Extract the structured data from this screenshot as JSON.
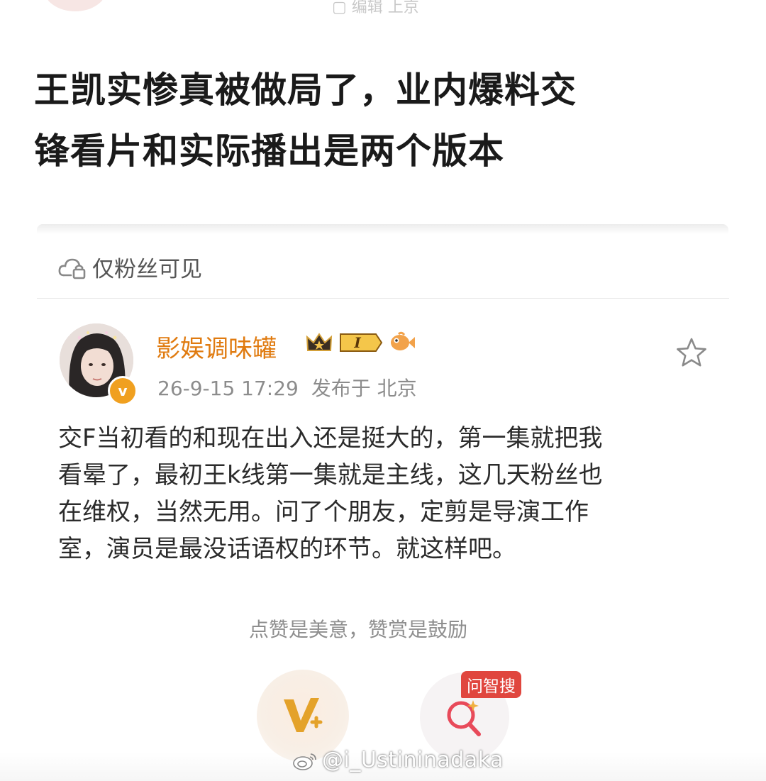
{
  "header": {
    "meta_partial": "▢ 编辑 上京"
  },
  "article": {
    "title_line1": "王凯实惨真被做局了，业内爆料交",
    "title_line2": "锋看片和实际播出是两个版本"
  },
  "post": {
    "visibility_label": "仅粉丝可见",
    "author_name": "影娱调味罐",
    "verified_mark": "v",
    "level_badge": "I",
    "timestamp": "26-9-15 17:29",
    "location": "发布于 北京",
    "body_lines": [
      "交F当初看的和现在出入还是挺大的，第一集就把我",
      "看晕了，最初王k线第一集就是主线，这几天粉丝也",
      "在维权，当然无用。问了个朋友，定剪是导演工作",
      "室，演员是最没话语权的环节。就这样吧。"
    ]
  },
  "actions": {
    "like_hint": "点赞是美意，赞赏是鼓励",
    "ai_badge": "问智搜"
  },
  "watermark": {
    "handle": "@i_Ustininadaka"
  },
  "colors": {
    "author_orange": "#e07b10",
    "verified_orange": "#f0a020",
    "ai_red": "#e0463e"
  },
  "icons": [
    "lock-cloud-icon",
    "crown-icon",
    "level-badge-icon",
    "fish-icon",
    "star-icon",
    "v-plus-icon",
    "smart-search-icon",
    "weibo-logo-icon"
  ]
}
